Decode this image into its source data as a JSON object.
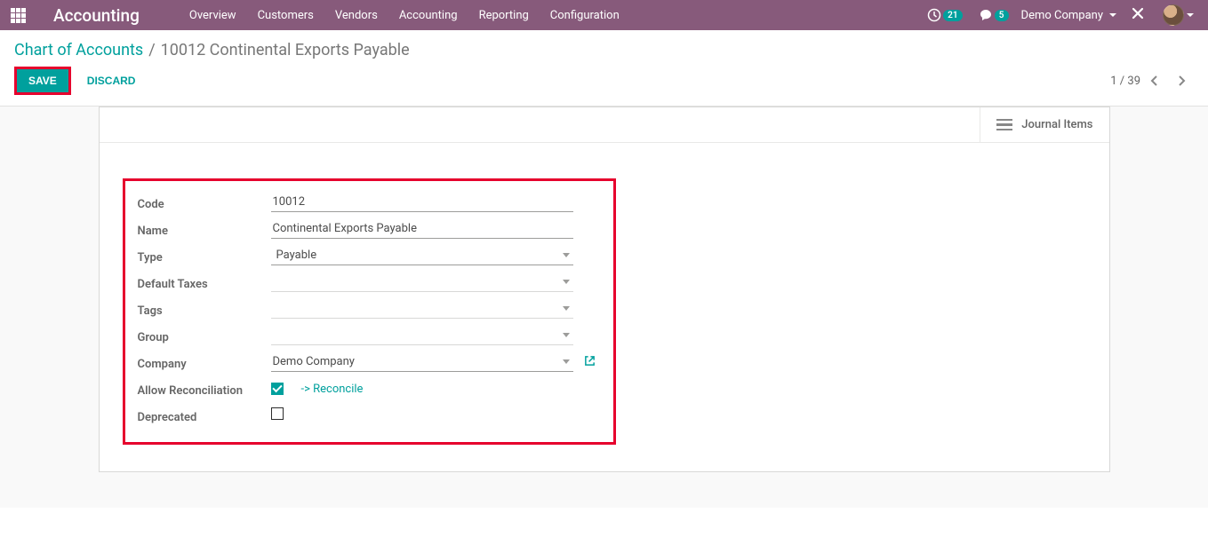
{
  "navbar": {
    "app_title": "Accounting",
    "menu": [
      "Overview",
      "Customers",
      "Vendors",
      "Accounting",
      "Reporting",
      "Configuration"
    ],
    "activities_count": "21",
    "messages_count": "5",
    "company": "Demo Company"
  },
  "breadcrumb": {
    "parent": "Chart of Accounts",
    "current": "10012 Continental Exports Payable"
  },
  "actions": {
    "save": "SAVE",
    "discard": "DISCARD"
  },
  "pager": "1 / 39",
  "stat_button": "Journal Items",
  "form": {
    "labels": {
      "code": "Code",
      "name": "Name",
      "type": "Type",
      "default_taxes": "Default Taxes",
      "tags": "Tags",
      "group": "Group",
      "company": "Company",
      "allow_reconciliation": "Allow Reconciliation",
      "deprecated": "Deprecated"
    },
    "values": {
      "code": "10012",
      "name": "Continental Exports Payable",
      "type": "Payable",
      "default_taxes": "",
      "tags": "",
      "group": "",
      "company": "Demo Company",
      "allow_reconciliation": true,
      "deprecated": false
    },
    "reconcile_link": "-> Reconcile"
  }
}
